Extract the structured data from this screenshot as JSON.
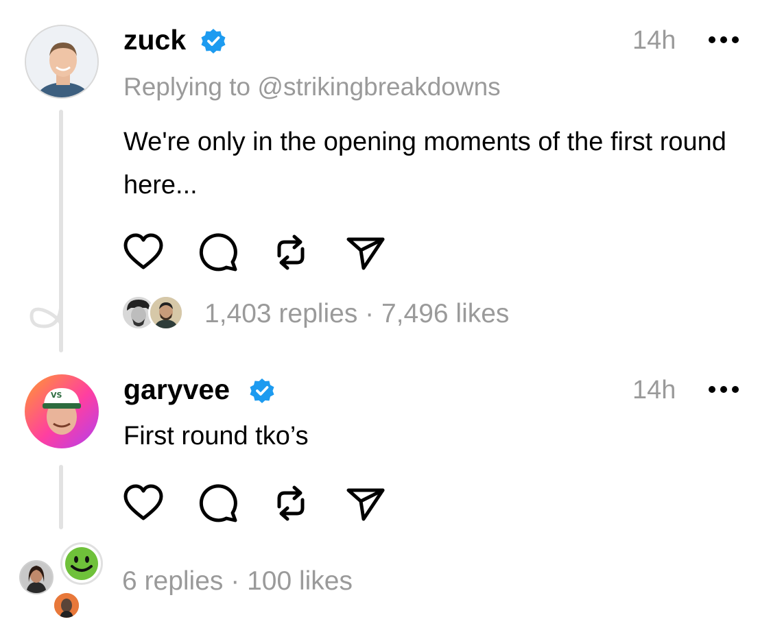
{
  "posts": [
    {
      "username": "zuck",
      "verified": true,
      "timestamp": "14h",
      "replying_to": "Replying to @strikingbreakdowns",
      "text": "We're only in the opening moments of the first round here...",
      "stats": "1,403 replies · 7,496 likes",
      "avatar_icon": "user-avatar-photo"
    },
    {
      "username": "garyvee",
      "verified": true,
      "timestamp": "14h",
      "text": "First round tko’s",
      "stats": "6 replies · 100 likes",
      "avatar_icon": "user-avatar-photo"
    }
  ],
  "icons": {
    "like": "heart-icon",
    "reply": "comment-bubble-icon",
    "repost": "repost-icon",
    "share": "send-icon",
    "more": "more-options-icon",
    "verified": "verified-badge-icon"
  },
  "colors": {
    "verified_blue": "#1d9bf0",
    "muted_text": "#9a9a9a",
    "thread_line": "#e2e2e2"
  }
}
